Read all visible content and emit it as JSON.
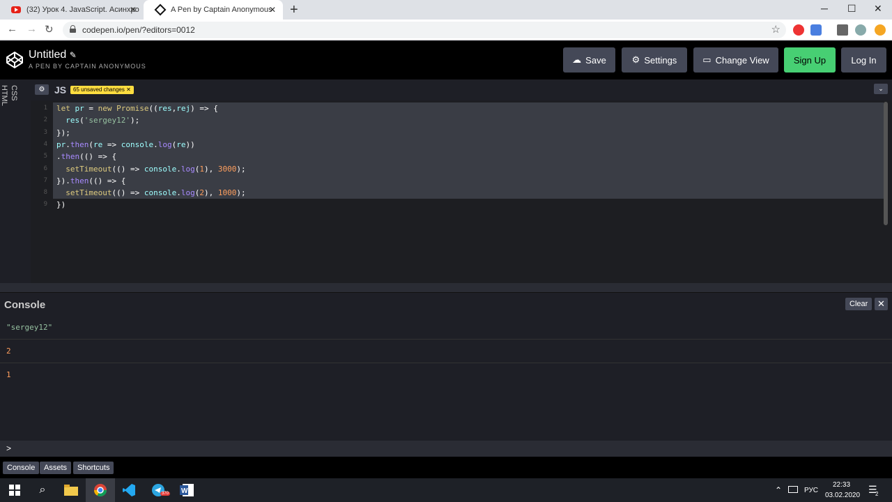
{
  "browser": {
    "tabs": [
      {
        "title": "(32) Урок 4. JavaScript. Асинхро",
        "icon": "youtube-icon",
        "active": false
      },
      {
        "title": "A Pen by Captain Anonymous",
        "icon": "codepen-icon",
        "active": true
      }
    ],
    "url": "codepen.io/pen/?editors=0012"
  },
  "header": {
    "title": "Untitled",
    "subtitle": "A PEN BY CAPTAIN ANONYMOUS",
    "buttons": {
      "save": "Save",
      "settings": "Settings",
      "change_view": "Change View",
      "sign_up": "Sign Up",
      "log_in": "Log In"
    }
  },
  "editor": {
    "side_tabs": [
      "CSS",
      "HTML"
    ],
    "label": "JS",
    "unsaved": "65 unsaved changes",
    "lines": [
      "let pr = new Promise((res,rej) => {",
      "  res('sergey12');",
      "});",
      "pr.then(re => console.log(re))",
      ".then(() => {",
      "  setTimeout(() => console.log(1), 3000);",
      "}).then(() => {",
      "  setTimeout(() => console.log(2), 1000);",
      "})"
    ]
  },
  "console": {
    "title": "Console",
    "clear": "Clear",
    "close": "✕",
    "logs": [
      "\"sergey12\"",
      "2",
      "1"
    ],
    "prompt": ">"
  },
  "footer": {
    "buttons": [
      "Console",
      "Assets",
      "Shortcuts"
    ]
  },
  "taskbar": {
    "lang": "РУС",
    "time": "22:33",
    "date": "03.02.2020",
    "telegram_badge": "370",
    "notifications": "2"
  },
  "colors": {
    "accent_green": "#47cf73",
    "badge_yellow": "#ffdd40",
    "button_bg": "#444857"
  }
}
